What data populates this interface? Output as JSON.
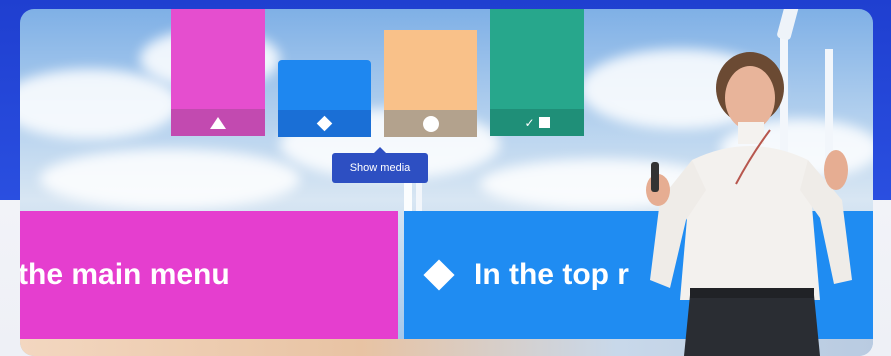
{
  "cards": [
    {
      "color": "#e54ecf",
      "strip_color": "#c24ab0",
      "icon": "triangle-icon"
    },
    {
      "color": "#1e87f0",
      "strip_color": "#1a6fd6",
      "icon": "diamond-icon"
    },
    {
      "color": "#f9c189",
      "strip_color": "#b3a28d",
      "icon": "circle-icon"
    },
    {
      "color": "#27a78c",
      "strip_color": "#1f8f78",
      "icon": "check-square-icon",
      "check_glyph": "✓"
    }
  ],
  "show_media": {
    "label": "Show media",
    "color": "#2d4fc2"
  },
  "banners": {
    "left": {
      "text": "the main menu",
      "color": "#e53ecf"
    },
    "right": {
      "text": "In the top r",
      "color": "#1f8cf2",
      "icon": "diamond-icon"
    }
  }
}
